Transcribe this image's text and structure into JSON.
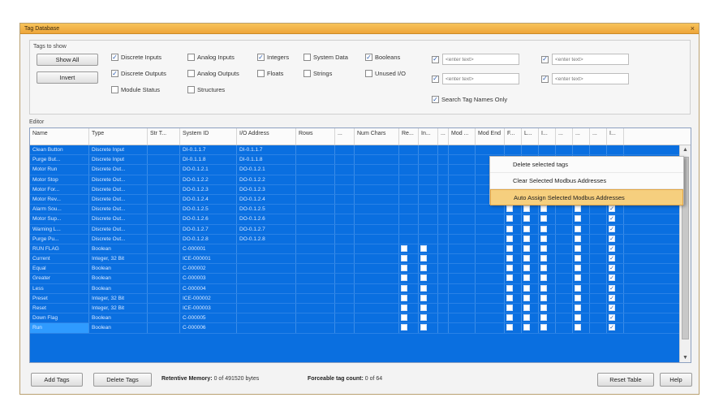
{
  "window": {
    "title": "Tag Database",
    "close": "×"
  },
  "filters": {
    "group_label": "Tags to show",
    "show_all": "Show All",
    "invert": "Invert",
    "checkboxes": [
      {
        "label": "Discrete Inputs",
        "checked": true
      },
      {
        "label": "Analog Inputs",
        "checked": false
      },
      {
        "label": "Integers",
        "checked": true
      },
      {
        "label": "System Data",
        "checked": false
      },
      {
        "label": "Booleans",
        "checked": true
      },
      {
        "label": "Discrete Outputs",
        "checked": true
      },
      {
        "label": "Analog Outputs",
        "checked": false
      },
      {
        "label": "Floats",
        "checked": false
      },
      {
        "label": "Strings",
        "checked": false
      },
      {
        "label": "Unused I/O",
        "checked": false
      },
      {
        "label": "Module Status",
        "checked": false
      },
      {
        "label": "Structures",
        "checked": false
      }
    ],
    "text_filters": [
      {
        "placeholder": "<enter text>",
        "checked": true
      },
      {
        "placeholder": "<enter text>",
        "checked": true
      },
      {
        "placeholder": "<enter text>",
        "checked": true
      },
      {
        "placeholder": "<enter text>",
        "checked": true
      }
    ],
    "search_names_only": {
      "label": "Search Tag Names Only",
      "checked": true
    }
  },
  "editor": {
    "label": "Editor",
    "columns": [
      "Name",
      "Type",
      "Str T...",
      "System ID",
      "I/O Address",
      "Rows",
      "...",
      "Num Chars",
      "Re...",
      "In...",
      "...",
      "Mod ...",
      "Mod End",
      "F...",
      "L...",
      "I...",
      "...",
      "...",
      "...",
      "I..."
    ],
    "rows": [
      {
        "name": "Clean Button",
        "type": "Discrete Input",
        "sysid": "DI-0.1.1.7",
        "io": "DI-0.1.1.7"
      },
      {
        "name": "Purge But...",
        "type": "Discrete Input",
        "sysid": "DI-0.1.1.8",
        "io": "DI-0.1.1.8"
      },
      {
        "name": "Motor Run",
        "type": "Discrete Out...",
        "sysid": "DO-0.1.2.1",
        "io": "DO-0.1.2.1"
      },
      {
        "name": "Motor Stop",
        "type": "Discrete Out...",
        "sysid": "DO-0.1.2.2",
        "io": "DO-0.1.2.2"
      },
      {
        "name": "Motor For...",
        "type": "Discrete Out...",
        "sysid": "DO-0.1.2.3",
        "io": "DO-0.1.2.3"
      },
      {
        "name": "Motor Rev...",
        "type": "Discrete Out...",
        "sysid": "DO-0.1.2.4",
        "io": "DO-0.1.2.4"
      },
      {
        "name": "Alarm Sou...",
        "type": "Discrete Out...",
        "sysid": "DO-0.1.2.5",
        "io": "DO-0.1.2.5"
      },
      {
        "name": "Motor Sup...",
        "type": "Discrete Out...",
        "sysid": "DO-0.1.2.6",
        "io": "DO-0.1.2.6"
      },
      {
        "name": "Warning L...",
        "type": "Discrete Out...",
        "sysid": "DO-0.1.2.7",
        "io": "DO-0.1.2.7"
      },
      {
        "name": "Purge Pu...",
        "type": "Discrete Out...",
        "sysid": "DO-0.1.2.8",
        "io": "DO-0.1.2.8"
      },
      {
        "name": "RUN FLAG",
        "type": "Boolean",
        "sysid": "C-000001",
        "io": ""
      },
      {
        "name": "Current",
        "type": "Integer, 32 Bit",
        "sysid": "ICE-000001",
        "io": ""
      },
      {
        "name": "Equal",
        "type": "Boolean",
        "sysid": "C-000002",
        "io": ""
      },
      {
        "name": "Greater",
        "type": "Boolean",
        "sysid": "C-000003",
        "io": ""
      },
      {
        "name": "Less",
        "type": "Boolean",
        "sysid": "C-000004",
        "io": ""
      },
      {
        "name": "Preset",
        "type": "Integer, 32 Bit",
        "sysid": "ICE-000002",
        "io": ""
      },
      {
        "name": "Reset",
        "type": "Integer, 32 Bit",
        "sysid": "ICE-000003",
        "io": ""
      },
      {
        "name": "Down Flag",
        "type": "Boolean",
        "sysid": "C-000005",
        "io": ""
      },
      {
        "name": "Run",
        "type": "Boolean",
        "sysid": "C-000006",
        "io": ""
      }
    ]
  },
  "context_menu": [
    "Delete selected tags",
    "Clear Selected Modbus Addresses",
    "Auto Assign Selected Modbus Addresses"
  ],
  "footer": {
    "add_tags": "Add Tags",
    "delete_tags": "Delete Tags",
    "retentive_label": "Retentive Memory:",
    "retentive_value": "0 of 491520 bytes",
    "forceable_label": "Forceable tag count:",
    "forceable_value": "0 of 64",
    "reset_table": "Reset Table",
    "help": "Help"
  },
  "colors": {
    "selection": "#0a6fe0",
    "titlebar": "#eea53a",
    "menu_highlight": "#f6cf7e"
  }
}
